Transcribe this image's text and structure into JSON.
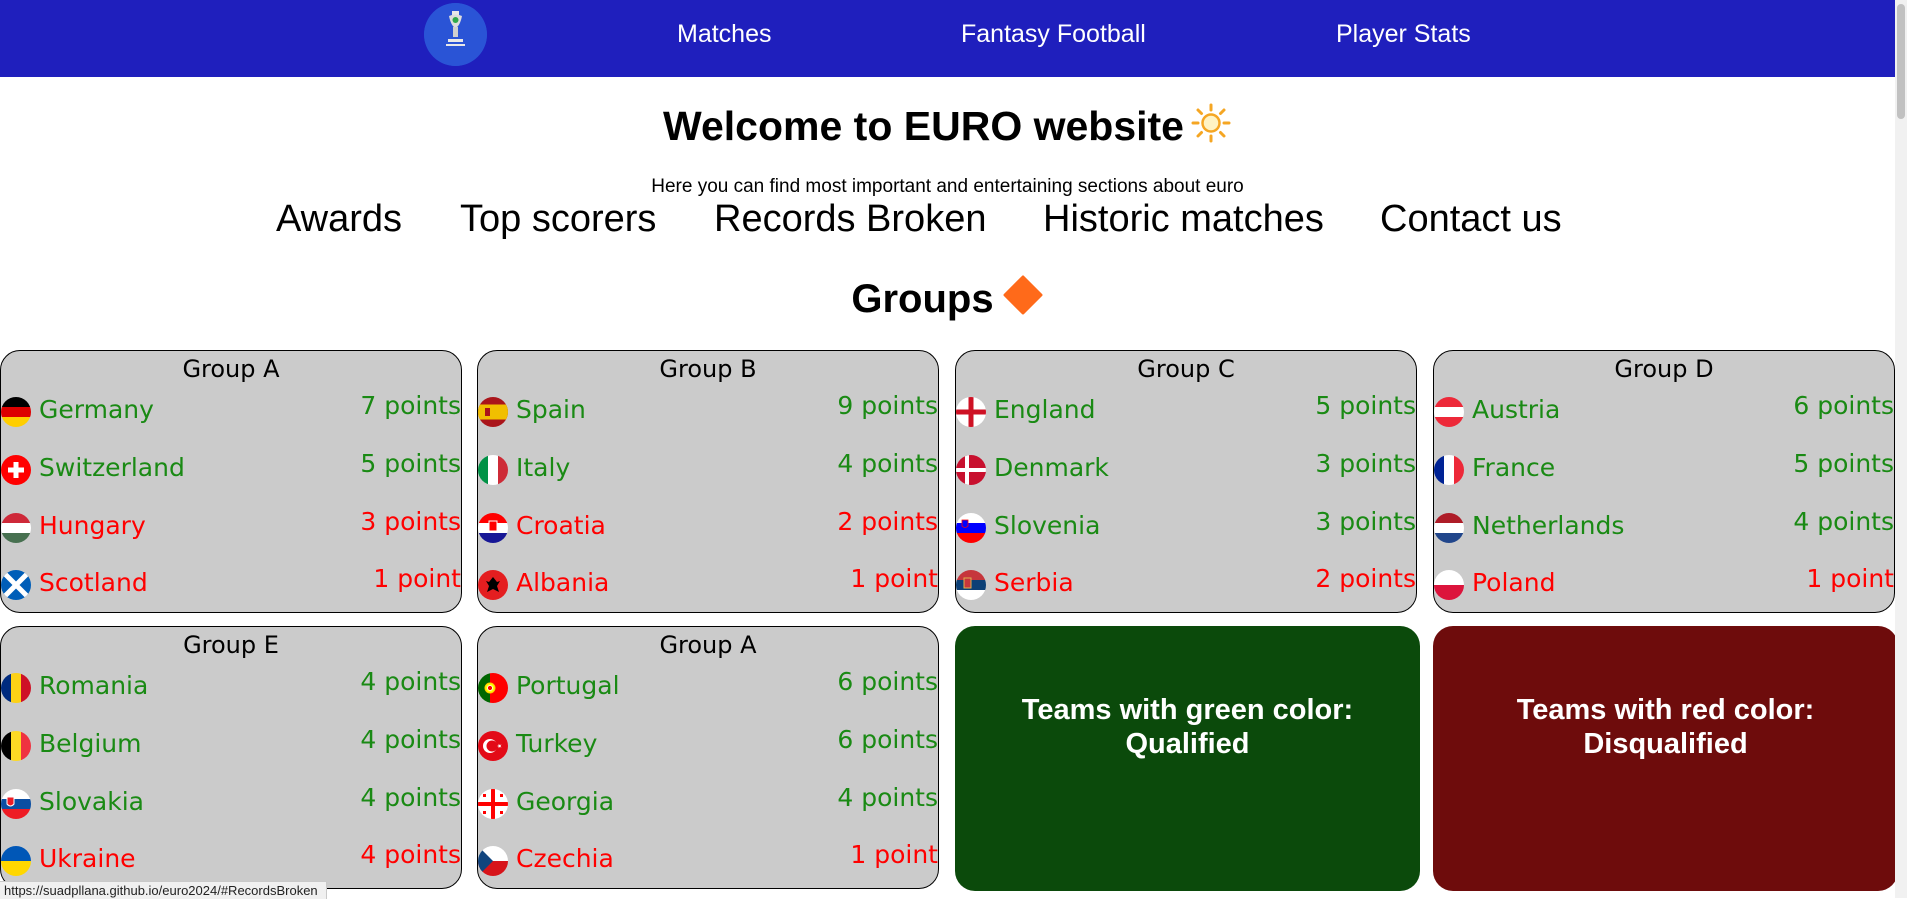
{
  "nav": {
    "links": [
      "Matches",
      "Fantasy Football",
      "Player Stats"
    ]
  },
  "welcome": {
    "title": "Welcome to EURO website",
    "subtitle": "Here you can find most important and entertaining sections about euro"
  },
  "sections": [
    "Awards",
    "Top scorers",
    "Records Broken",
    "Historic matches",
    "Contact us"
  ],
  "groups_heading": "Groups",
  "colors": {
    "qualified": "#1a8a14",
    "disqualified": "#ff0000",
    "nav_bg": "#1f1fbd",
    "qualified_card": "#0b4a0b",
    "disqualified_card": "#6e0c0c"
  },
  "groups": [
    {
      "title": "Group A",
      "teams": [
        {
          "name": "Germany",
          "points": "7 points",
          "status": "qualified",
          "flag": "germany-flag-icon"
        },
        {
          "name": "Switzerland",
          "points": "5 points",
          "status": "qualified",
          "flag": "switzerland-flag-icon"
        },
        {
          "name": "Hungary",
          "points": "3 points",
          "status": "disqualified",
          "flag": "hungary-flag-icon"
        },
        {
          "name": "Scotland",
          "points": "1 point",
          "status": "disqualified",
          "flag": "scotland-flag-icon"
        }
      ]
    },
    {
      "title": "Group B",
      "teams": [
        {
          "name": "Spain",
          "points": "9 points",
          "status": "qualified",
          "flag": "spain-flag-icon"
        },
        {
          "name": "Italy",
          "points": "4 points",
          "status": "qualified",
          "flag": "italy-flag-icon"
        },
        {
          "name": "Croatia",
          "points": "2 points",
          "status": "disqualified",
          "flag": "croatia-flag-icon"
        },
        {
          "name": "Albania",
          "points": "1 point",
          "status": "disqualified",
          "flag": "albania-flag-icon"
        }
      ]
    },
    {
      "title": "Group C",
      "teams": [
        {
          "name": "England",
          "points": "5 points",
          "status": "qualified",
          "flag": "england-flag-icon"
        },
        {
          "name": "Denmark",
          "points": "3 points",
          "status": "qualified",
          "flag": "denmark-flag-icon"
        },
        {
          "name": "Slovenia",
          "points": "3 points",
          "status": "qualified",
          "flag": "slovenia-flag-icon"
        },
        {
          "name": "Serbia",
          "points": "2 points",
          "status": "disqualified",
          "flag": "serbia-flag-icon"
        }
      ]
    },
    {
      "title": "Group D",
      "teams": [
        {
          "name": "Austria",
          "points": "6 points",
          "status": "qualified",
          "flag": "austria-flag-icon"
        },
        {
          "name": "France",
          "points": "5 points",
          "status": "qualified",
          "flag": "france-flag-icon"
        },
        {
          "name": "Netherlands",
          "points": "4 points",
          "status": "qualified",
          "flag": "netherlands-flag-icon"
        },
        {
          "name": "Poland",
          "points": "1 point",
          "status": "disqualified",
          "flag": "poland-flag-icon"
        }
      ]
    },
    {
      "title": "Group E",
      "teams": [
        {
          "name": "Romania",
          "points": "4 points",
          "status": "qualified",
          "flag": "romania-flag-icon"
        },
        {
          "name": "Belgium",
          "points": "4 points",
          "status": "qualified",
          "flag": "belgium-flag-icon"
        },
        {
          "name": "Slovakia",
          "points": "4 points",
          "status": "qualified",
          "flag": "slovakia-flag-icon"
        },
        {
          "name": "Ukraine",
          "points": "4 points",
          "status": "disqualified",
          "flag": "ukraine-flag-icon"
        }
      ]
    },
    {
      "title": "Group A",
      "teams": [
        {
          "name": "Portugal",
          "points": "6 points",
          "status": "qualified",
          "flag": "portugal-flag-icon"
        },
        {
          "name": "Turkey",
          "points": "6 points",
          "status": "qualified",
          "flag": "turkey-flag-icon"
        },
        {
          "name": "Georgia",
          "points": "4 points",
          "status": "qualified",
          "flag": "georgia-flag-icon"
        },
        {
          "name": "Czechia",
          "points": "1 point",
          "status": "disqualified",
          "flag": "czechia-flag-icon"
        }
      ]
    }
  ],
  "legend": {
    "green_line1": "Teams with green color:",
    "green_line2": "Qualified",
    "red_line1": "Teams with red color:",
    "red_line2": "Disqualified"
  },
  "status_url": "https://suadpllana.github.io/euro2024/#RecordsBroken",
  "icons": {
    "title_icon": "sun-icon",
    "groups_icon": "orange-diamond-icon",
    "logo": "euro-2024-logo"
  }
}
